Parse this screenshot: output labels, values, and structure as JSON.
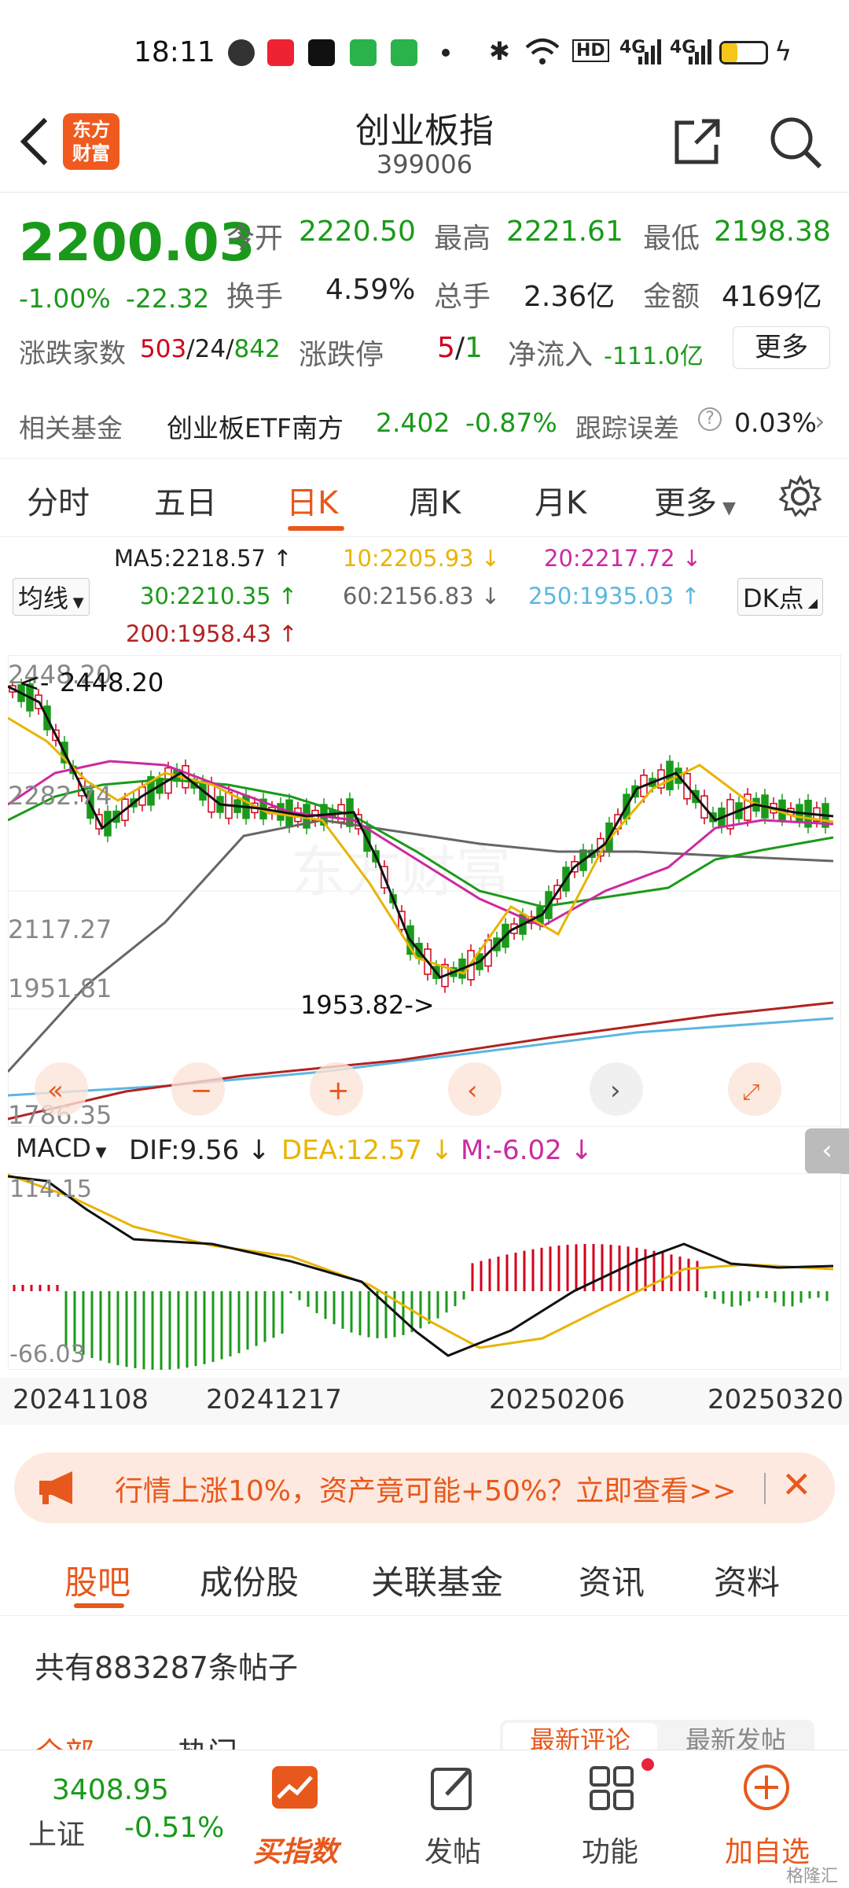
{
  "status": {
    "time": "18:11",
    "net1": "4G",
    "net2": "4G",
    "hd": "HD"
  },
  "header": {
    "title": "创业板指",
    "code": "399006",
    "logo_line1": "东方",
    "logo_line2": "财富"
  },
  "quote": {
    "price": "2200.03",
    "change_pct": "-1.00%",
    "change": "-22.32",
    "open_label": "今开",
    "open": "2220.50",
    "high_label": "最高",
    "high": "2221.61",
    "low_label": "最低",
    "low": "2198.38",
    "turnover_label": "换手",
    "turnover": "4.59%",
    "vol_label": "总手",
    "vol": "2.36亿",
    "amount_label": "金额",
    "amount": "4169亿",
    "updown_label": "涨跌家数",
    "up": "503",
    "flat": "24",
    "down": "842",
    "limit_label": "涨跌停",
    "limit_up": "5",
    "limit_down": "1",
    "netflow_label": "净流入",
    "netflow": "-111.0亿",
    "more": "更多"
  },
  "fund": {
    "label": "相关基金",
    "name": "创业板ETF南方",
    "price": "2.402",
    "pct": "-0.87%",
    "track_label": "跟踪误差",
    "track": "0.03%"
  },
  "tabs": [
    "分时",
    "五日",
    "日K",
    "周K",
    "月K",
    "更多"
  ],
  "ma": {
    "selector": "均线",
    "ma5": "MA5:2218.57",
    "ma10": "10:2205.93",
    "ma20": "20:2217.72",
    "ma30": "30:2210.35",
    "ma60": "60:2156.83",
    "ma250": "250:1935.03",
    "ma200": "200:1958.43",
    "dk": "DK点"
  },
  "chart": {
    "yticks": [
      "2448.20",
      "2282.74",
      "2117.27",
      "1951.81",
      "1786.35"
    ],
    "hi_label": "2448.20",
    "lo_label": "1953.82->"
  },
  "macd": {
    "selector": "MACD",
    "dif": "DIF:9.56",
    "dea": "DEA:12.57",
    "m": "M:-6.02",
    "top": "114.15",
    "bottom": "-66.03"
  },
  "dates": [
    "20241108",
    "20241217",
    "20250206",
    "20250320"
  ],
  "banner": {
    "text": "行情上涨10%，资产竟可能+50%？立即查看>>"
  },
  "sectabs": [
    "股吧",
    "成份股",
    "关联基金",
    "资讯",
    "资料"
  ],
  "posts": {
    "text": "共有883287条帖子"
  },
  "subtabs": {
    "left1": "全部",
    "left2": "热门",
    "right1": "最新评论",
    "right2": "最新发帖"
  },
  "bottom": {
    "sh_price": "3408.95",
    "sh_name": "上证",
    "sh_pct": "-0.51%",
    "buy": "买指数",
    "post": "发帖",
    "func": "功能",
    "add": "加自选"
  },
  "watermark": "格隆汇",
  "chart_data": {
    "type": "candlestick",
    "ylim": [
      1786.35,
      2448.2
    ],
    "series": [
      {
        "name": "MA5",
        "color": "#222222"
      },
      {
        "name": "MA10",
        "color": "#e8b400"
      },
      {
        "name": "MA20",
        "color": "#cc2aa0"
      },
      {
        "name": "MA30",
        "color": "#1a9a1a"
      },
      {
        "name": "MA60",
        "color": "#666666"
      },
      {
        "name": "MA200",
        "color": "#b22222"
      },
      {
        "name": "MA250",
        "color": "#5bb7e0"
      }
    ]
  }
}
